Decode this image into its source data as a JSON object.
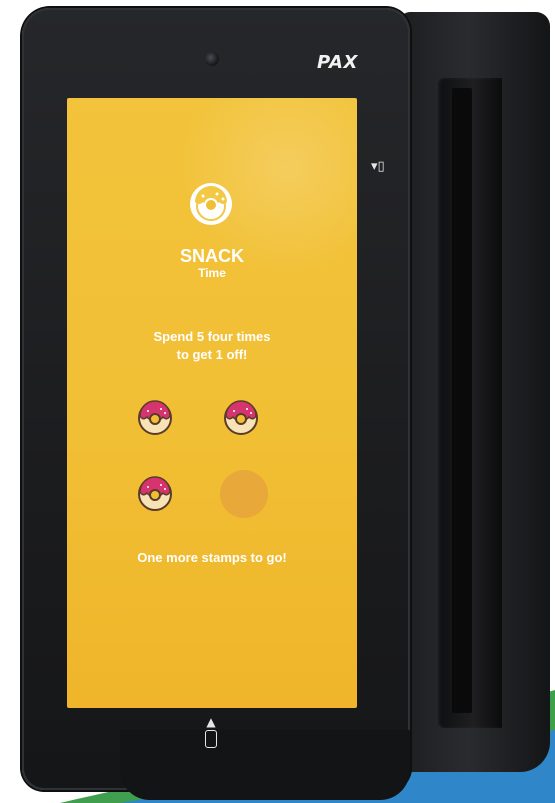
{
  "device": {
    "brand": "PAX",
    "card_slot_icon": "card-insert-icon",
    "nfc_icon": "contactless-phone-icon"
  },
  "screen": {
    "header_icon": "donut-icon",
    "title": "SNACK",
    "subtitle": "Time",
    "promo_line1": "Spend 5 four times",
    "promo_line2": "to get 1 off!",
    "stamps": [
      {
        "state": "filled",
        "icon": "donut-icon"
      },
      {
        "state": "filled",
        "icon": "donut-icon"
      },
      {
        "state": "filled",
        "icon": "donut-icon"
      },
      {
        "state": "empty"
      }
    ],
    "stamps_collected": 3,
    "stamps_total": 4,
    "status": "One more stamps to go!"
  },
  "colors": {
    "screen_bg": "#f1bf34",
    "empty_stamp": "#e8a83a",
    "donut_frosting": "#d6346f",
    "donut_dough": "#f7e3b5",
    "text": "#ffffff"
  }
}
